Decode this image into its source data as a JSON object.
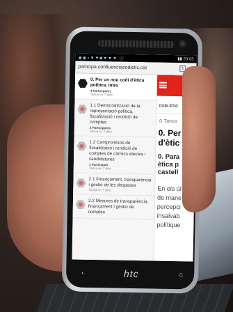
{
  "statusbar": {
    "icons": "◉◉◖▼▼◙▼▼▼ ⓘ",
    "right": "▮▮ 20:03"
  },
  "browser": {
    "url": "participa.confluenciacodietic.cat",
    "tab_count": "1",
    "menu": "⋮"
  },
  "list": [
    {
      "title": "0. Per un nou codi d'ètica política. Intro",
      "participants": "4 Participants",
      "date": "Tanca en 7 dies",
      "active": true
    },
    {
      "title": "1.1 Democratització de la representació política, fiscalització i rendició de comptes",
      "participants": "2 Participants",
      "date": "Tanca en 7 dies",
      "active": false
    },
    {
      "title": "1.2 Compromisos de fiscalització i rendició de comptes de càrrecs electes i candidatures",
      "participants": "1 Participant",
      "date": "Tanca en 7 dies",
      "active": false
    },
    {
      "title": "2.1 Finançament, transparència i gestió de les despeses",
      "participants": "",
      "date": "Tanca en 7 dies",
      "active": false
    },
    {
      "title": "2.2 Mesures de transparència, finançament i gestió de comptes",
      "participants": "",
      "date": "",
      "active": false
    }
  ],
  "main": {
    "section_label": "CODI ÈTIC",
    "meta": "⊙ Tanca",
    "title_line1": "0. Per",
    "title_line2": "d'ètic",
    "subtitle_line1": "0. Para",
    "subtitle_line2": "ètica p",
    "subtitle_line3": "castell",
    "body_lines": [
      "En els úl",
      "de mane",
      "percepci",
      "insalvab",
      "polítique"
    ]
  },
  "device": {
    "brand": "htc",
    "back": "‹",
    "home": "⌂"
  }
}
